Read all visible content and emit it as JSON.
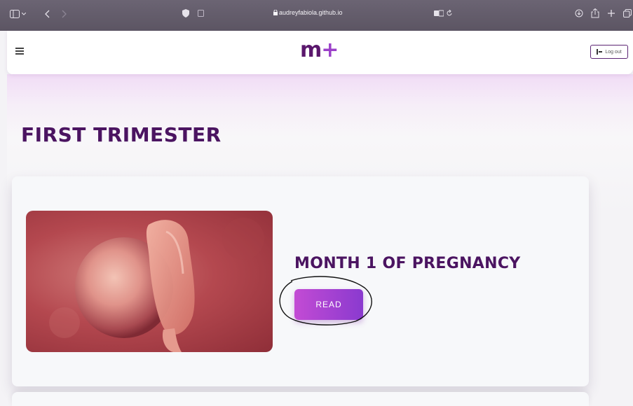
{
  "browser": {
    "url": "audreyfabiola.github.io"
  },
  "header": {
    "logo_main": "m",
    "logo_plus": "+",
    "logout_label": "Log out"
  },
  "section": {
    "title": "FIRST TRIMESTER"
  },
  "card": {
    "title": "MONTH 1 OF PREGNANCY",
    "read_label": "READ",
    "image_desc": "fetus-embryo-illustration"
  },
  "colors": {
    "brand": "#5a176c",
    "accent": "#9b40c9",
    "button_gradient_start": "#c34bd4",
    "button_gradient_end": "#8a3acf"
  },
  "icons": [
    "sidebar-icon",
    "back-chevron-icon",
    "forward-chevron-icon",
    "shield-icon",
    "lock-icon",
    "translate-icon",
    "reload-icon",
    "download-icon",
    "share-icon",
    "new-tab-icon",
    "tabs-icon",
    "hamburger-menu-icon",
    "logout-icon"
  ]
}
